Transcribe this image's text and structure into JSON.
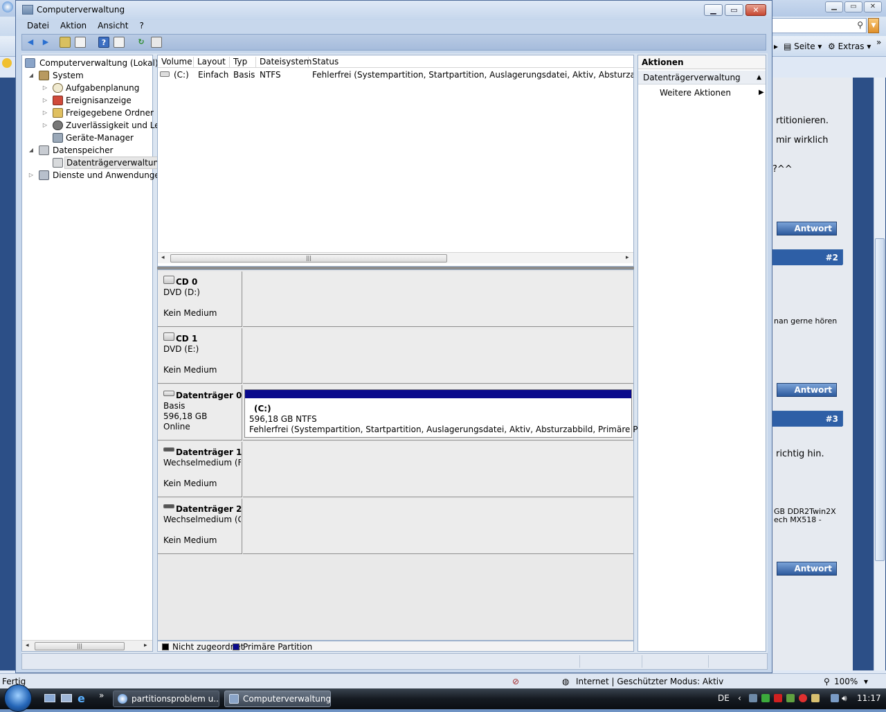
{
  "ie": {
    "command_bar": {
      "page": "Seite",
      "tools": "Extras"
    },
    "forum": {
      "texts": [
        "rtitionieren.",
        "mir wirklich",
        "?^^",
        "nan gerne hören",
        "richtig hin."
      ],
      "specs": [
        "GB DDR2Twin2X",
        "ech MX518 -"
      ],
      "posts": [
        "#2",
        "#3"
      ],
      "reply_label": "Antwort"
    },
    "status": {
      "left": "Fertig",
      "zone": "Internet | Geschützter Modus: Aktiv",
      "zoom": "100%"
    }
  },
  "mmc": {
    "title": "Computerverwaltung",
    "menu": [
      "Datei",
      "Aktion",
      "Ansicht",
      "?"
    ],
    "tree": {
      "root": "Computerverwaltung (Lokal)",
      "system": "System",
      "tasks": "Aufgabenplanung",
      "events": "Ereignisanzeige",
      "shares": "Freigegebene Ordner",
      "reliability": "Zuverlässigkeit und Leis",
      "devices": "Geräte-Manager",
      "storage": "Datenspeicher",
      "diskmgmt": "Datenträgerverwaltung",
      "services": "Dienste und Anwendungen"
    },
    "volume_list": {
      "columns": [
        "Volume",
        "Layout",
        "Typ",
        "Dateisystem",
        "Status"
      ],
      "rows": [
        {
          "volume": "(C:)",
          "layout": "Einfach",
          "type": "Basis",
          "fs": "NTFS",
          "status": "Fehlerfrei (Systempartition, Startpartition, Auslagerungsdatei, Aktiv, Absturzabbild, Primä"
        }
      ]
    },
    "disks": [
      {
        "name": "CD 0",
        "line1": "DVD (D:)",
        "line2": "",
        "line3": "Kein Medium"
      },
      {
        "name": "CD 1",
        "line1": "DVD (E:)",
        "line2": "",
        "line3": "Kein Medium"
      },
      {
        "name": "Datenträger 0",
        "line1": "Basis",
        "line2": "596,18 GB",
        "line3": "Online"
      },
      {
        "name": "Datenträger 1",
        "line1": "Wechselmedium (F:",
        "line2": "",
        "line3": "Kein Medium"
      },
      {
        "name": "Datenträger 2",
        "line1": "Wechselmedium (G:",
        "line2": "",
        "line3": "Kein Medium"
      }
    ],
    "partition": {
      "label": "(C:)",
      "size": "596,18 GB NTFS",
      "status": "Fehlerfrei (Systempartition, Startpartition, Auslagerungsdatei, Aktiv, Absturzabbild, Primäre Partition)",
      "color": "#0a0a8c"
    },
    "legend": [
      {
        "label": "Nicht zugeordnet",
        "color": "#000000"
      },
      {
        "label": "Primäre Partition",
        "color": "#0a0a8c"
      }
    ],
    "actions": {
      "title": "Aktionen",
      "section": "Datenträgerverwaltung",
      "more": "Weitere Aktionen"
    }
  },
  "taskbar": {
    "tasks": [
      "partitionsproblem u...",
      "Computerverwaltung"
    ],
    "lang": "DE",
    "clock": "11:17"
  }
}
